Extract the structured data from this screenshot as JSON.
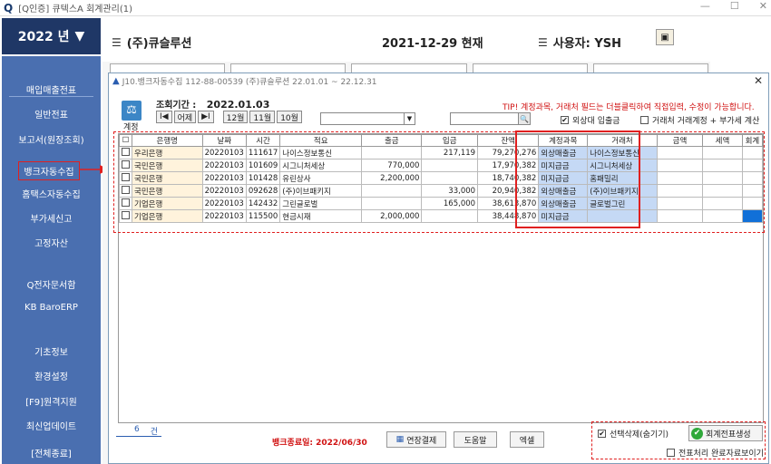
{
  "window": {
    "title": "[Q인증] 큐텍스A   회계관리(1)",
    "logo": "Q",
    "btn_min": "—",
    "btn_max": "☐",
    "btn_close": "✕"
  },
  "year": {
    "label": "2022 년",
    "arrow": "▼"
  },
  "header": {
    "company": "(주)큐슬루션",
    "date": "2021-12-29 현재",
    "user": "사용자: YSH",
    "list_glyph": "☰",
    "icon_glyph": "▣"
  },
  "sidebar": {
    "items": [
      "매입매출전표",
      "일반전표",
      "보고서(원장조회)",
      "뱅크자동수집",
      "홈택스자동수집",
      "부가세신고",
      "고정자산",
      "Q전자문서함",
      "KB BaroERP",
      "기초정보",
      "환경설정",
      "[F9]원격지원",
      "최신업데이트",
      "[전체종료]"
    ]
  },
  "dialog": {
    "title": "J10.뱅크자동수집   112-88-00539  (주)큐슬루션 22.01.01 ~ 22.12.31",
    "close": "✕",
    "acct_label": "계정",
    "acct_glyph": "⚖",
    "period_label": "조회기간  :",
    "period_value": "2022.01.03",
    "nav": {
      "first": "I◀",
      "prev": "어제",
      "next": "▶I",
      "m12": "12월",
      "m11": "11월",
      "m10": "10월"
    },
    "combo_arrow": "▼",
    "search_glyph": "🔍",
    "tip": "TIP! 계정과목, 거래처 필드는 더블클릭하여 직접입력, 수정이 가능합니다.",
    "opt_foreign": "외상대 입출금",
    "opt_vat": "거래처 거래계정 + 부가세 계산",
    "check_mark": "✔"
  },
  "table": {
    "headers": [
      "☐",
      "은행명",
      "날짜",
      "시간",
      "적요",
      "출금",
      "입금",
      "잔액",
      "계정과목",
      "거래처",
      "금액",
      "세액",
      "회계"
    ],
    "rows": [
      [
        "우리은행",
        "20220103",
        "111617",
        "나이스정보통신",
        "",
        "217,119",
        "79,270,276",
        "외상매출금",
        "나이스정보통신"
      ],
      [
        "국민은행",
        "20220103",
        "101609",
        "시그니처세상",
        "770,000",
        "",
        "17,970,382",
        "미지급금",
        "시그니처세상"
      ],
      [
        "국민은행",
        "20220103",
        "101428",
        "유린상사",
        "2,200,000",
        "",
        "18,740,382",
        "미지급금",
        "홈패밀리"
      ],
      [
        "국민은행",
        "20220103",
        "092628",
        "(주)이브패키지",
        "",
        "33,000",
        "20,940,382",
        "외상매출금",
        "(주)이브패키지"
      ],
      [
        "기업은행",
        "20220103",
        "142432",
        "그린글로벌",
        "",
        "165,000",
        "38,613,870",
        "외상매출금",
        "글로벌그린"
      ],
      [
        "기업은행",
        "20220103",
        "115500",
        "현금시재",
        "2,000,000",
        "",
        "38,448,870",
        "미지급금",
        ""
      ]
    ]
  },
  "footer": {
    "count": "6",
    "count_unit": "건",
    "end_notice": "뱅크종료일: 2022/06/30",
    "btn_extend": "연장결제",
    "btn_extend_glyph": "▦",
    "btn_help": "도움말",
    "btn_excel": "엑셀",
    "opt_hide": "선택삭제(숨기기)",
    "btn_generate": "회계전표생성",
    "ok_glyph": "✔",
    "opt_show_done": "전표처리 완료자료보이기"
  }
}
